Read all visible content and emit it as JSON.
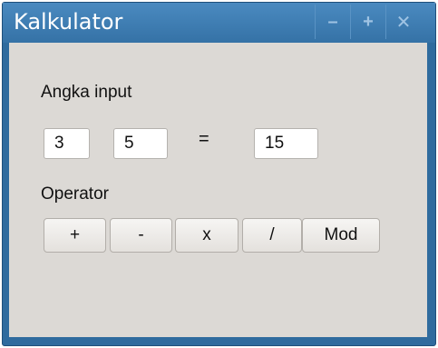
{
  "window": {
    "title": "Kalkulator",
    "controls": {
      "minimize": "–",
      "maximize": "+",
      "close": "✕"
    }
  },
  "form": {
    "input_label": "Angka input",
    "operand1": "3",
    "operand2": "5",
    "equals": "=",
    "result": "15",
    "operator_label": "Operator"
  },
  "operators": [
    "+",
    "-",
    "x",
    "/",
    "Mod"
  ],
  "colors": {
    "titlebar": "#3a78ad",
    "client_bg": "#dcd9d5",
    "button_bg": "#ecebe8"
  }
}
